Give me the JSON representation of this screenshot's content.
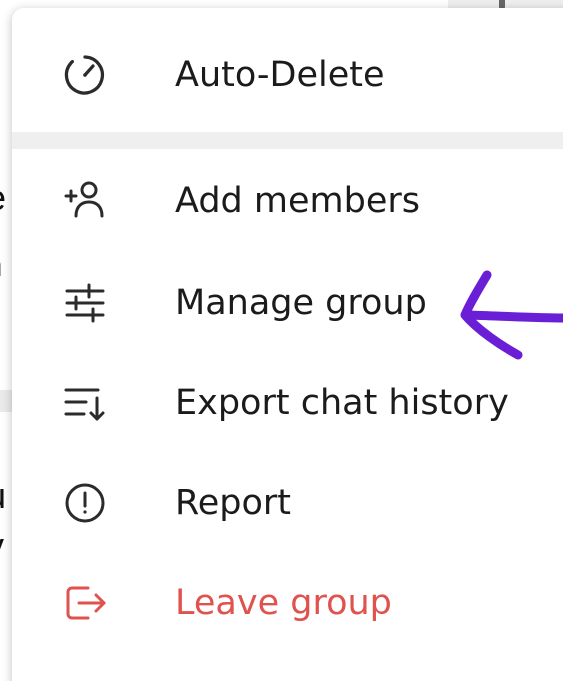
{
  "menu": {
    "items": [
      {
        "id": "auto-delete",
        "label": "Auto-Delete",
        "icon": "timer-icon"
      },
      {
        "id": "add-members",
        "label": "Add members",
        "icon": "add-user-icon"
      },
      {
        "id": "manage-group",
        "label": "Manage group",
        "icon": "sliders-icon"
      },
      {
        "id": "export-chat-history",
        "label": "Export chat history",
        "icon": "export-list-icon"
      },
      {
        "id": "report",
        "label": "Report",
        "icon": "alert-circle-icon"
      },
      {
        "id": "leave-group",
        "label": "Leave group",
        "icon": "logout-icon"
      }
    ]
  },
  "colors": {
    "text": "#1b1b1b",
    "danger": "#e0524e",
    "separator": "#efefef",
    "annotation": "#6a1fd6",
    "icon": "#2b2b2b"
  }
}
